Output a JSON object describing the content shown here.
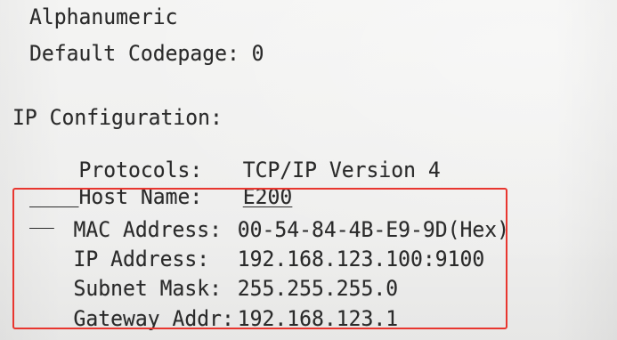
{
  "printout": {
    "top_lines": {
      "alphanumeric": "Alphanumeric",
      "default_codepage": "Default Codepage: 0"
    },
    "section_title": "IP Configuration:",
    "rows": [
      {
        "label": "Protocols:",
        "value": "TCP/IP Version 4"
      },
      {
        "label": "Host Name:",
        "value": "E200"
      },
      {
        "label": "MAC Address:",
        "value": "00-54-84-4B-E9-9D(Hex)"
      },
      {
        "label": "IP Address:",
        "value": "192.168.123.100:9100"
      },
      {
        "label": "Subnet Mask:",
        "value": "255.255.255.0"
      },
      {
        "label": "Gateway Addr:",
        "value": "192.168.123.1"
      }
    ]
  },
  "annotation": {
    "highlight_color": "#e8362f"
  }
}
